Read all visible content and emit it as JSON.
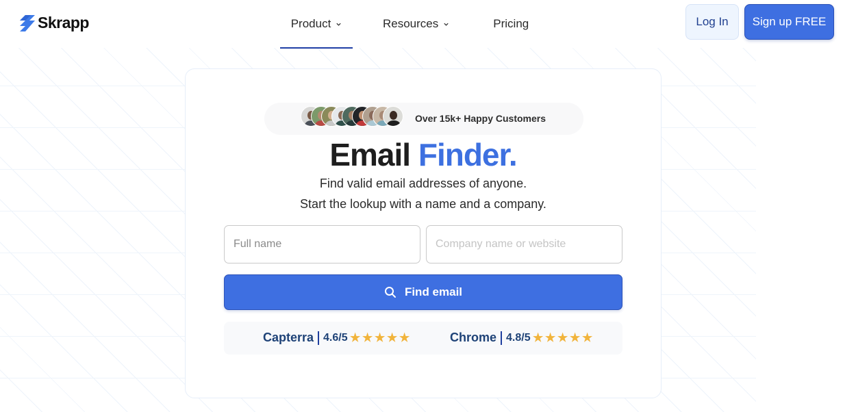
{
  "header": {
    "brand": "Skrapp",
    "nav": [
      {
        "label": "Product",
        "has_dropdown": true,
        "active": true
      },
      {
        "label": "Resources",
        "has_dropdown": true,
        "active": false
      },
      {
        "label": "Pricing",
        "has_dropdown": false,
        "active": false
      }
    ],
    "login_label": "Log In",
    "signup_label": "Sign up FREE"
  },
  "hero": {
    "badge_text": "Over 15k+ Happy Customers",
    "avatar_count": 9,
    "title_main": "Email",
    "title_accent": "Finder.",
    "subtitle_line1": "Find valid email addresses of anyone.",
    "subtitle_line2": "Start the lookup with a name and a company."
  },
  "form": {
    "full_name": {
      "value": "",
      "placeholder": "Full name"
    },
    "company": {
      "value": "",
      "placeholder": "Company name or website"
    },
    "submit_label": "Find email"
  },
  "ratings": [
    {
      "source": "Capterra",
      "score": "4.6/5",
      "stars": 5
    },
    {
      "source": "Chrome",
      "score": "4.8/5",
      "stars": 5
    }
  ],
  "colors": {
    "accent": "#3e6fe1",
    "title_accent": "#3d70e0",
    "rating_text": "#1e4277",
    "star": "#f1b43c",
    "nav_active_underline": "#1f3fa6"
  }
}
